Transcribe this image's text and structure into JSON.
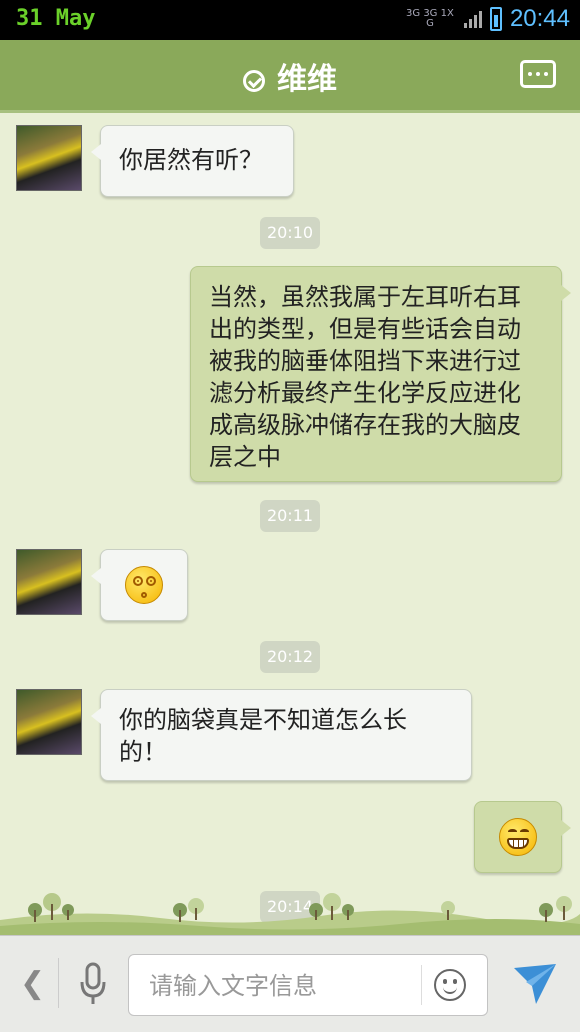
{
  "status_bar": {
    "date": "31 May",
    "network": "3G 3G 1X G",
    "time": "20:44"
  },
  "header": {
    "title": "维维",
    "verified_icon": "check-circle-icon",
    "more_icon": "more-dots-icon"
  },
  "messages": [
    {
      "id": 0,
      "side": "in",
      "type": "text",
      "text": "你居然有听？"
    },
    {
      "id": 1,
      "type": "time",
      "text": "20:10"
    },
    {
      "id": 2,
      "side": "out",
      "type": "text",
      "text": "当然，虽然我属于左耳听右耳出的类型，但是有些话会自动被我的脑垂体阻挡下来进行过滤分析最终产生化学反应进化成高级脉冲储存在我的大脑皮层之中"
    },
    {
      "id": 3,
      "type": "time",
      "text": "20:11"
    },
    {
      "id": 4,
      "side": "in",
      "type": "emoji",
      "emoji": "dizzy-face-emoji"
    },
    {
      "id": 5,
      "type": "time",
      "text": "20:12"
    },
    {
      "id": 6,
      "side": "in",
      "type": "text",
      "text": "你的脑袋真是不知道怎么长的！"
    },
    {
      "id": 7,
      "side": "out",
      "type": "emoji",
      "emoji": "grin-face-emoji"
    },
    {
      "id": 8,
      "type": "time",
      "text": "20:14"
    }
  ],
  "input_bar": {
    "placeholder": "请输入文字信息",
    "value": "",
    "back_icon": "chevron-left-icon",
    "mic_icon": "microphone-icon",
    "emoji_icon": "smiley-icon",
    "send_icon": "send-paper-plane-icon"
  },
  "colors": {
    "header": "#8aa95a",
    "chat_bg": "#e9efd6",
    "bubble_in": "#f4f6f3",
    "bubble_out": "#cfdca9",
    "status_accent": "#5fc0ff"
  }
}
